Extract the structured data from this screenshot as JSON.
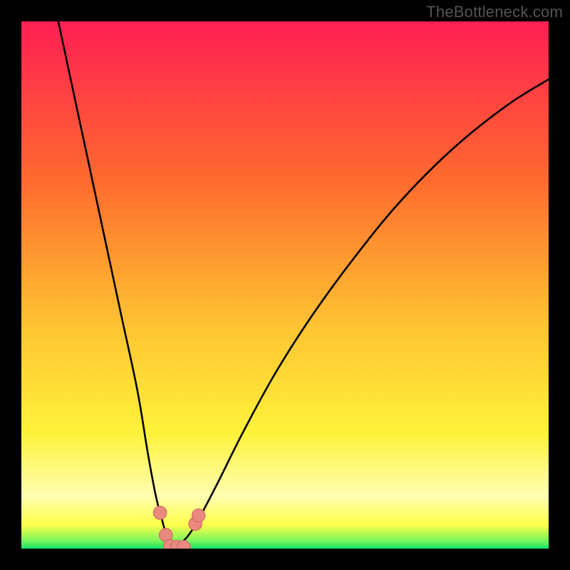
{
  "watermark": "TheBottleneck.com",
  "colors": {
    "frame": "#000000",
    "grad_top": "#ff1f54",
    "grad_mid1": "#ff6a2e",
    "grad_mid2": "#ffc432",
    "grad_mid3": "#fff23a",
    "grad_pale": "#ffffb0",
    "grad_green": "#14e36a",
    "curve": "#000000",
    "dot_fill": "#e9897f",
    "dot_stroke": "#d06a60"
  },
  "chart_data": {
    "type": "line",
    "title": "",
    "xlabel": "",
    "ylabel": "",
    "xlim": [
      0,
      100
    ],
    "ylim": [
      0,
      100
    ],
    "series": [
      {
        "name": "left-branch",
        "x": [
          7,
          10,
          13,
          16,
          19,
          22,
          24,
          25.5,
          26.8,
          27.5,
          28.1,
          28.6
        ],
        "y": [
          100,
          86,
          72,
          58,
          44,
          30,
          18,
          10,
          5,
          2.5,
          1.0,
          0.0
        ]
      },
      {
        "name": "right-branch",
        "x": [
          28.6,
          30.5,
          33,
          37,
          42,
          48,
          55,
          63,
          72,
          82,
          92,
          100
        ],
        "y": [
          0.0,
          1.2,
          4.5,
          12,
          22,
          33,
          44,
          55,
          66,
          76,
          84,
          89
        ]
      }
    ],
    "markers": {
      "name": "highlight-dots",
      "x": [
        26.3,
        27.4,
        28.2,
        29.6,
        30.8,
        33.0,
        33.6
      ],
      "y": [
        6.8,
        2.6,
        0.5,
        0.3,
        0.3,
        4.7,
        6.3
      ]
    },
    "gradient_stops": [
      {
        "pos": 0.0,
        "color": "#ff1f54"
      },
      {
        "pos": 0.3,
        "color": "#ff6a2e"
      },
      {
        "pos": 0.58,
        "color": "#ffc432"
      },
      {
        "pos": 0.78,
        "color": "#fff23a"
      },
      {
        "pos": 0.9,
        "color": "#ffffb0"
      },
      {
        "pos": 0.955,
        "color": "#ffff4a"
      },
      {
        "pos": 0.985,
        "color": "#7af55a"
      },
      {
        "pos": 1.0,
        "color": "#14e36a"
      }
    ]
  }
}
